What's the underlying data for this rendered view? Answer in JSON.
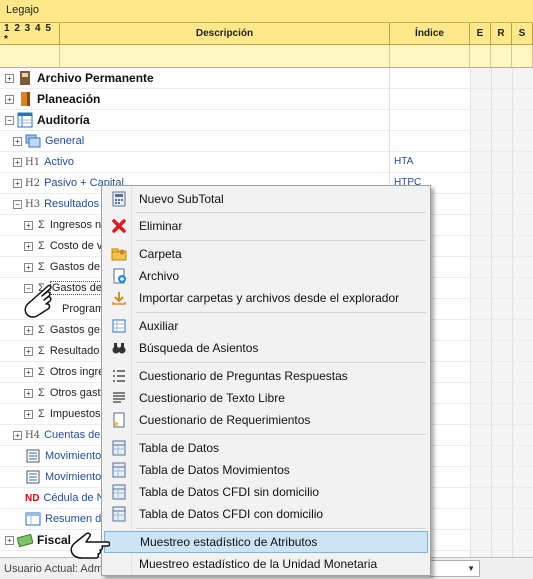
{
  "window": {
    "title": "Legajo"
  },
  "columns": {
    "levels": "1 2 3 4 5 *",
    "description": "Descripción",
    "index": "Índice",
    "e": "E",
    "r": "R",
    "s": "S"
  },
  "tree": {
    "r0": {
      "label": "Archivo Permanente"
    },
    "r1": {
      "label": "Planeación"
    },
    "r2": {
      "label": "Auditoría"
    },
    "r3": {
      "label": "General"
    },
    "r4": {
      "lvl": "H1",
      "label": "Activo",
      "index": "HTA"
    },
    "r5": {
      "lvl": "H2",
      "label": "Pasivo + Capital",
      "index": "HTPC"
    },
    "r6": {
      "lvl": "H3",
      "label": "Resultados"
    },
    "r7": {
      "label": "Ingresos n"
    },
    "r8": {
      "label": "Costo de v"
    },
    "r9": {
      "label": "Gastos de"
    },
    "r10": {
      "label": "Gastos de"
    },
    "r11": {
      "label": "Program"
    },
    "r12": {
      "label": "Gastos ge"
    },
    "r13": {
      "label": "Resultado"
    },
    "r14": {
      "label": "Otros ingre"
    },
    "r15": {
      "label": "Otros gast"
    },
    "r16": {
      "label": "Impuestos"
    },
    "r17": {
      "lvl": "H4",
      "label": "Cuentas de"
    },
    "r18": {
      "label": "Movimientos"
    },
    "r19": {
      "label": "Movimientos"
    },
    "r20": {
      "nd": "ND",
      "label": "Cédula de N"
    },
    "r21": {
      "label": "Resumen de"
    },
    "r22": {
      "label": "Fiscal"
    }
  },
  "status": {
    "user": "Usuario Actual: Admi",
    "combo_arrow": "▼"
  },
  "context_menu": {
    "items": [
      {
        "label": "Nuevo SubTotal"
      },
      {
        "label": "Eliminar"
      },
      {
        "label": "Carpeta"
      },
      {
        "label": "Archivo"
      },
      {
        "label": "Importar carpetas y archivos desde el explorador"
      },
      {
        "label": "Auxiliar"
      },
      {
        "label": "Búsqueda de Asientos"
      },
      {
        "label": "Cuestionario de Preguntas Respuestas"
      },
      {
        "label": "Cuestionario de Texto Libre"
      },
      {
        "label": "Cuestionario de Requerimientos"
      },
      {
        "label": "Tabla de Datos"
      },
      {
        "label": "Tabla de Datos Movimientos"
      },
      {
        "label": "Tabla de Datos CFDI sin domicilio"
      },
      {
        "label": "Tabla de Datos CFDI con domicilio"
      },
      {
        "label": "Muestreo estadístico de Atributos"
      },
      {
        "label": "Muestreo estadístico de la Unidad Monetaria"
      }
    ]
  },
  "colors": {
    "header_bg": "#ffe88a",
    "link_blue": "#1f4e9c",
    "highlight": "#cde4f7",
    "delete_red": "#d81e1e"
  }
}
